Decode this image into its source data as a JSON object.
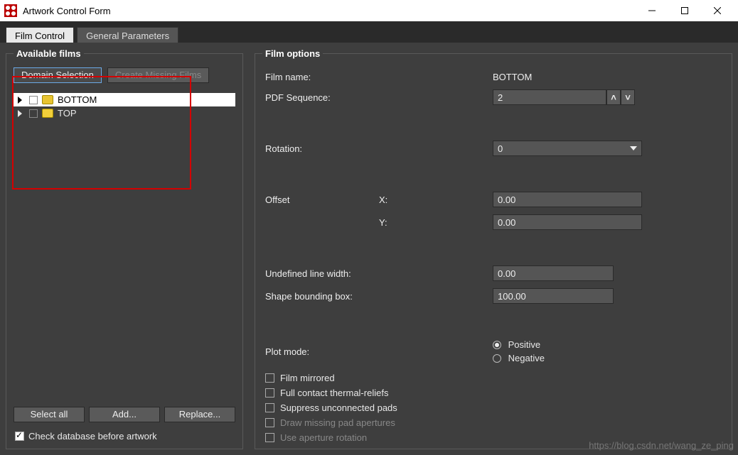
{
  "window": {
    "title": "Artwork Control Form"
  },
  "tabs": {
    "active": "Film Control",
    "other": "General Parameters"
  },
  "left_panel": {
    "legend": "Available films",
    "domain_btn": "Domain Selection",
    "create_missing_btn": "Create Missing Films",
    "tree": [
      {
        "name": "BOTTOM",
        "selected": true
      },
      {
        "name": "TOP",
        "selected": false
      }
    ],
    "select_all_btn": "Select all",
    "add_btn": "Add...",
    "replace_btn": "Replace...",
    "check_db_label": "Check database before artwork"
  },
  "right_panel": {
    "legend": "Film options",
    "film_name_label": "Film name:",
    "film_name_value": "BOTTOM",
    "pdf_seq_label": "PDF Sequence:",
    "pdf_seq_value": "2",
    "rotation_label": "Rotation:",
    "rotation_value": "0",
    "offset_label": "Offset",
    "offset_x_label": "X:",
    "offset_x_value": "0.00",
    "offset_y_label": "Y:",
    "offset_y_value": "0.00",
    "undef_lw_label": "Undefined line width:",
    "undef_lw_value": "0.00",
    "shape_bb_label": "Shape bounding box:",
    "shape_bb_value": "100.00",
    "plot_mode_label": "Plot mode:",
    "plot_mode_pos": "Positive",
    "plot_mode_neg": "Negative",
    "chk_film_mirrored": "Film mirrored",
    "chk_full_contact": "Full contact thermal-reliefs",
    "chk_suppress_pads": "Suppress unconnected pads",
    "chk_draw_missing": "Draw missing pad apertures",
    "chk_use_aperture": "Use aperture rotation"
  },
  "watermark": "https://blog.csdn.net/wang_ze_ping"
}
